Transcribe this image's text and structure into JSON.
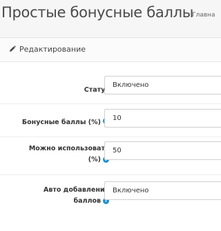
{
  "header": {
    "title": "Простые бонусные баллы",
    "breadcrumb": "Главна"
  },
  "panel": {
    "title": "Редактирование",
    "icon": "pencil-icon"
  },
  "form": {
    "status": {
      "label": "Статус",
      "value": "Включено"
    },
    "bonus_points": {
      "label": "Бонусные баллы (%)",
      "value": "10"
    },
    "can_use": {
      "label_line1": "Можно использовать",
      "label_line2": "(%)",
      "value": "50"
    },
    "auto_add": {
      "label_line1": "Авто добавление",
      "label_line2": "баллов",
      "value": "Включено"
    }
  },
  "help_icon_glyph": "?",
  "colors": {
    "help_icon": "#1e91cf"
  }
}
